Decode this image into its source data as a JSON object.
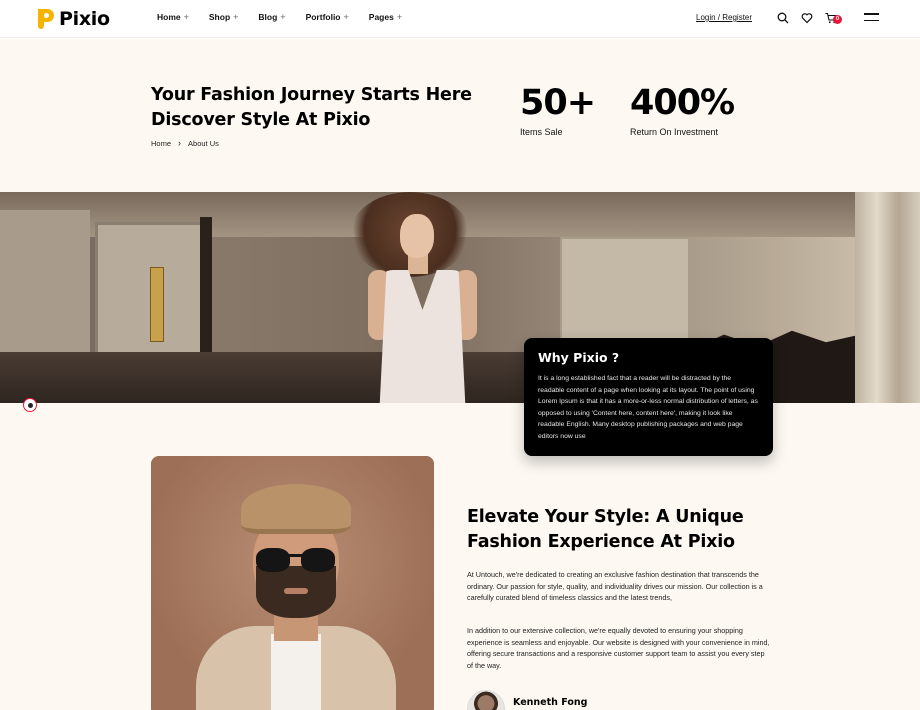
{
  "brand": {
    "name": "Pixio",
    "accent": "#f6b400",
    "badge_color": "#e8183a"
  },
  "nav": {
    "items": [
      {
        "label": "Home",
        "suffix": "+"
      },
      {
        "label": "Shop",
        "suffix": "+"
      },
      {
        "label": "Blog",
        "suffix": "+"
      },
      {
        "label": "Portfolio",
        "suffix": "+"
      },
      {
        "label": "Pages",
        "suffix": "+"
      }
    ],
    "login": "Login / Register",
    "cart_count": "0",
    "icons": [
      "search-icon",
      "heart-icon",
      "cart-icon",
      "menu-icon"
    ]
  },
  "hero": {
    "title_line1": "Your Fashion Journey Starts Here",
    "title_line2": "Discover Style At Pixio",
    "breadcrumb": {
      "home": "Home",
      "separator": "›",
      "current": "About Us"
    },
    "stats": [
      {
        "value": "50+",
        "label": "Items Sale"
      },
      {
        "value": "400%",
        "label": "Return On Investment"
      }
    ]
  },
  "why": {
    "title": "Why Pixio ?",
    "text": "It is a long established fact that a reader will be distracted by the readable content of a page when looking at its layout. The point of using Lorem Ipsum is that it has a more-or-less normal distribution of letters, as opposed to using 'Content here, content here', making it look like readable English. Many desktop publishing packages and web page editors now use"
  },
  "about": {
    "title_line1": "Elevate Your Style: A Unique",
    "title_line2": "Fashion Experience At Pixio",
    "p1": "At Untouch, we're dedicated to creating an exclusive fashion destination that transcends the ordinary. Our passion for style, quality, and individuality drives our mission. Our collection is a carefully curated blend of timeless classics and the latest trends,",
    "p2": "In addition to our extensive collection, we're equally devoted to ensuring your shopping experience is seamless and enjoyable. Our website is designed with your convenience in mind, offering secure transactions and a responsive customer support team to assist you every step of the way.",
    "author": "Kenneth Fong"
  }
}
